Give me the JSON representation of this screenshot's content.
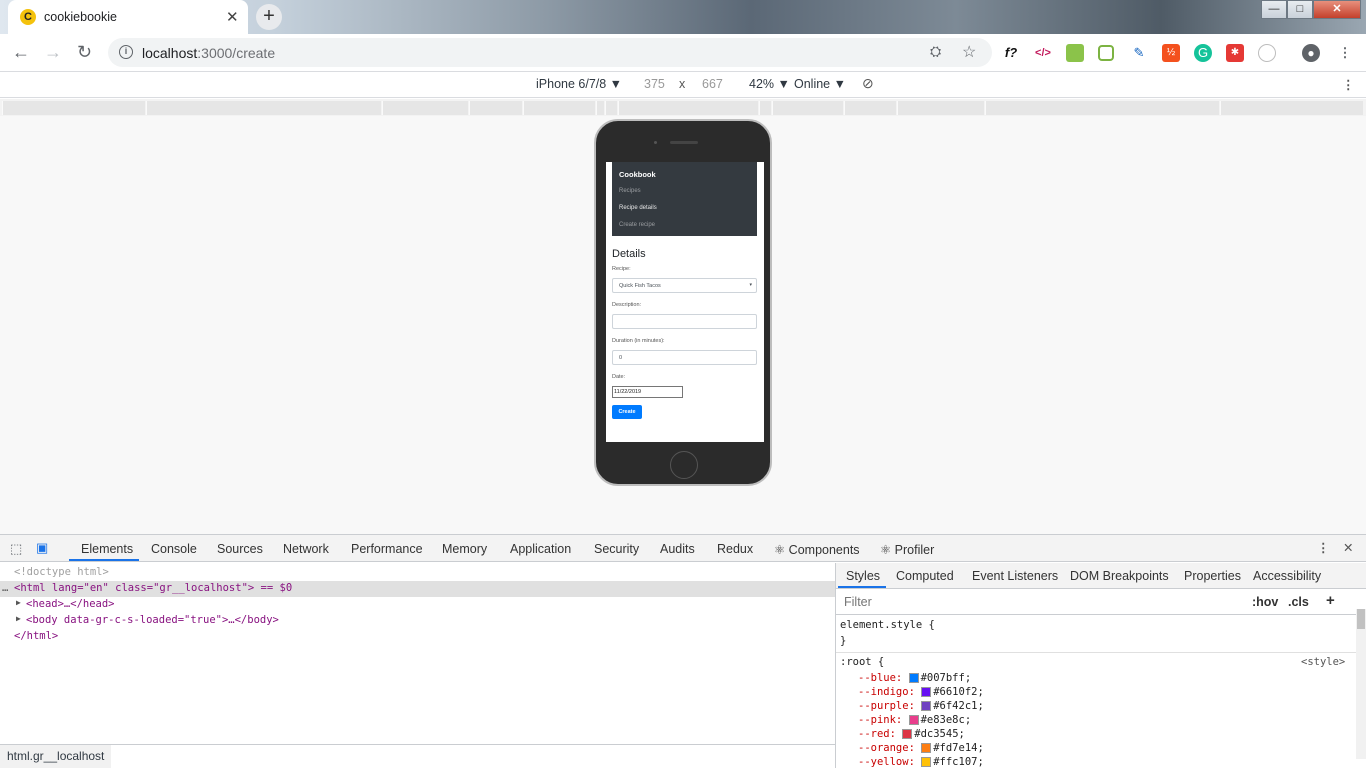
{
  "browser": {
    "tab_title": "cookiebookie",
    "tab_favicon": "C",
    "url_host": "localhost",
    "url_path": ":3000/create",
    "window_min": "—",
    "window_max": "□",
    "window_close": "✕"
  },
  "device_toolbar": {
    "device": "iPhone 6/7/8 ▼",
    "width": "375",
    "times": "x",
    "height": "667",
    "zoom": "42% ▼",
    "network": "Online ▼"
  },
  "app": {
    "brand": "Cookbook",
    "nav": [
      "Recipes",
      "Recipe details",
      "Create recipe"
    ],
    "heading": "Details",
    "recipe_label": "Recipe:",
    "recipe_value": "Quick Fish Tacos",
    "description_label": "Description:",
    "description_value": "",
    "duration_label": "Duration (in minutes):",
    "duration_value": "0",
    "date_label": "Date:",
    "date_value": "11/22/2019",
    "create_button": "Create"
  },
  "devtools": {
    "tabs": [
      "Elements",
      "Console",
      "Sources",
      "Network",
      "Performance",
      "Memory",
      "Application",
      "Security",
      "Audits",
      "Redux",
      "⚛ Components",
      "⚛ Profiler"
    ],
    "dom_lines": [
      "<!doctype html>",
      "<html lang=\"en\" class=\"gr__localhost\"> == $0",
      "<head>…</head>",
      "<body data-gr-c-s-loaded=\"true\">…</body>",
      "</html>"
    ],
    "breadcrumb": "html.gr__localhost",
    "side_tabs": [
      "Styles",
      "Computed",
      "Event Listeners",
      "DOM Breakpoints",
      "Properties",
      "Accessibility"
    ],
    "filter_placeholder": "Filter",
    "hov": ":hov",
    "cls": ".cls",
    "plus": "+",
    "element_style_open": "element.style {",
    "element_style_close": "}",
    "root_selector": ":root {",
    "root_source": "<style>",
    "vars": [
      {
        "name": "--blue:",
        "value": "#007bff;",
        "color": "#007bff"
      },
      {
        "name": "--indigo:",
        "value": "#6610f2;",
        "color": "#6610f2"
      },
      {
        "name": "--purple:",
        "value": "#6f42c1;",
        "color": "#6f42c1"
      },
      {
        "name": "--pink:",
        "value": "#e83e8c;",
        "color": "#e83e8c"
      },
      {
        "name": "--red:",
        "value": "#dc3545;",
        "color": "#dc3545"
      },
      {
        "name": "--orange:",
        "value": "#fd7e14;",
        "color": "#fd7e14"
      },
      {
        "name": "--yellow:",
        "value": "#ffc107;",
        "color": "#ffc107"
      }
    ]
  }
}
